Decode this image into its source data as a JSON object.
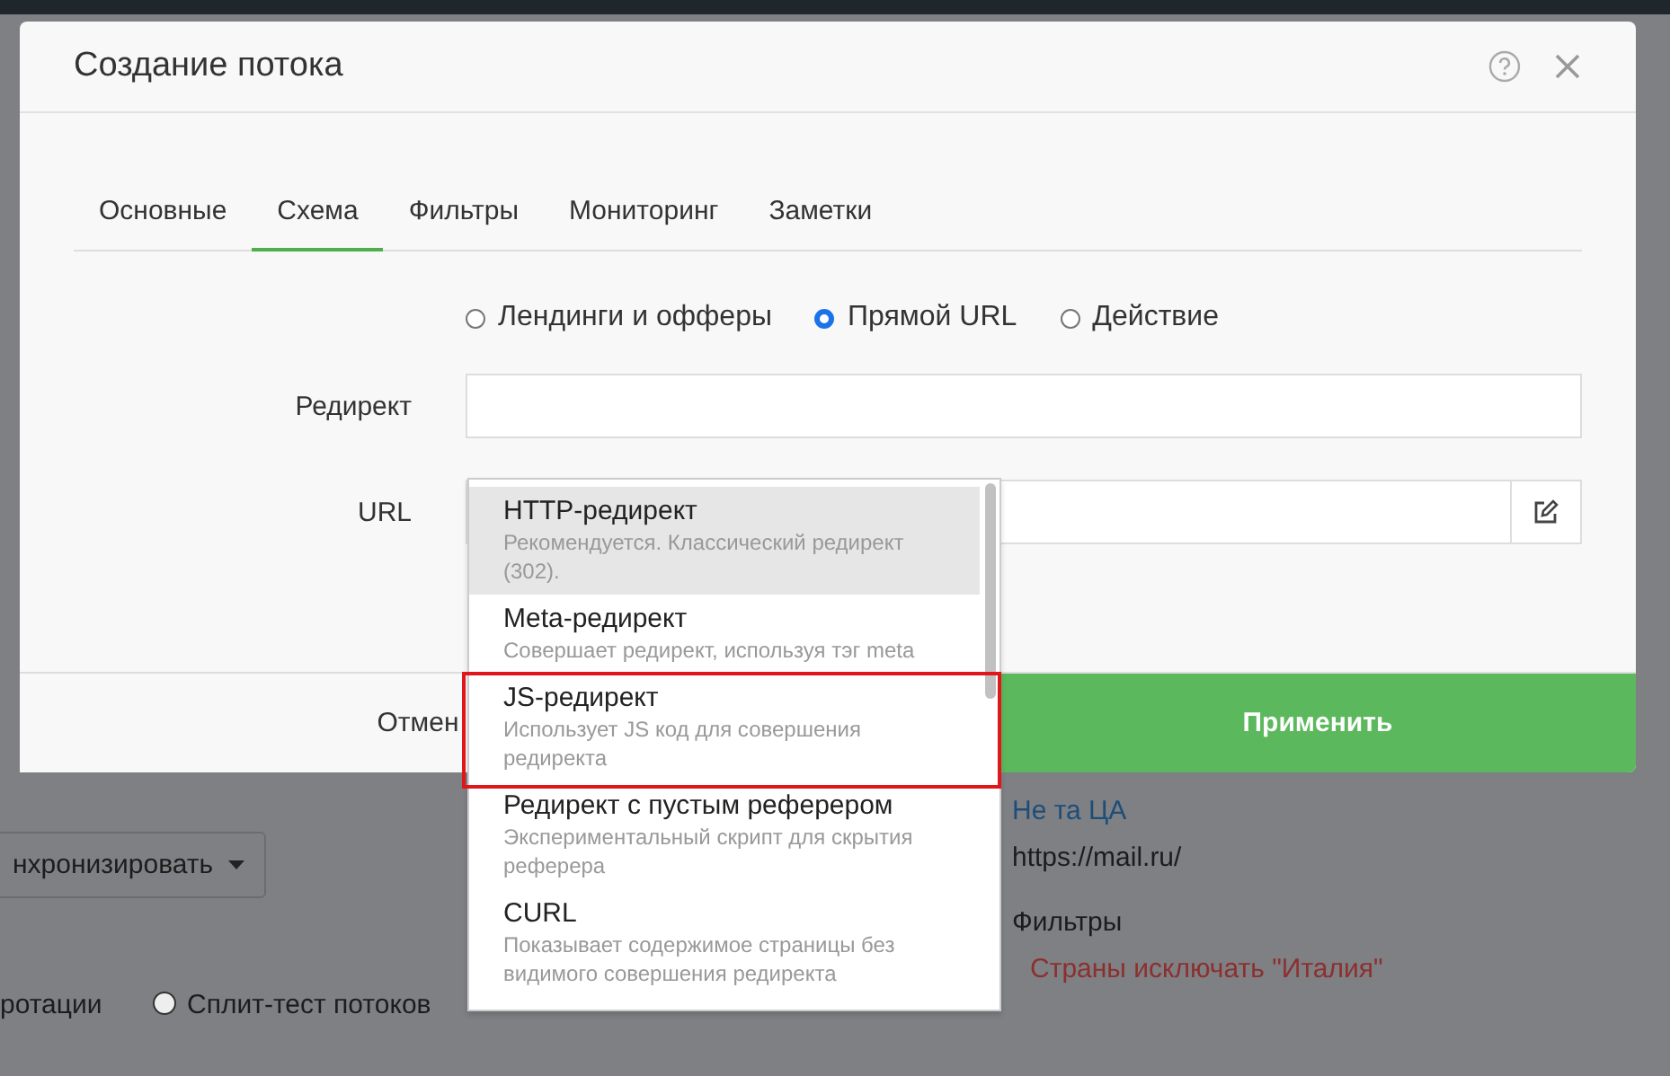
{
  "modal": {
    "title": "Создание потока",
    "tabs": [
      {
        "label": "Основные",
        "selected": false
      },
      {
        "label": "Схема",
        "selected": true
      },
      {
        "label": "Фильтры",
        "selected": false
      },
      {
        "label": "Мониторинг",
        "selected": false
      },
      {
        "label": "Заметки",
        "selected": false
      }
    ],
    "scheme_options": [
      {
        "label": "Лендинги и офферы",
        "selected": false
      },
      {
        "label": "Прямой URL",
        "selected": true
      },
      {
        "label": "Действие",
        "selected": false
      }
    ],
    "redirect_label": "Редирект",
    "url_label": "URL",
    "cancel_button": "Отмен",
    "apply_button": "Применить"
  },
  "dropdown": {
    "items": [
      {
        "title": "HTTP-редирект",
        "description": "Рекомендуется. Классический редирект (302).",
        "selected": true,
        "highlighted": false
      },
      {
        "title": "Meta-редирект",
        "description": "Совершает редирект, используя тэг meta",
        "selected": false,
        "highlighted": false
      },
      {
        "title": "JS-редирект",
        "description": "Использует JS код для совершения редиректа",
        "selected": false,
        "highlighted": true
      },
      {
        "title": "Редирект с пустым реферером",
        "description": "Экспериментальный скрипт для скрытия реферера",
        "selected": false,
        "highlighted": false
      },
      {
        "title": "CURL",
        "description": "Показывает содержимое страницы без видимого совершения редиректа",
        "selected": false,
        "highlighted": false
      }
    ]
  },
  "background": {
    "sync_button": "нхронизировать",
    "rotation_label": "ротации",
    "split_test": {
      "label": "Сплит-тест потоков",
      "selected": false
    },
    "link": "Не та ЦА",
    "url": "https://mail.ru/",
    "filters_label": "Фильтры",
    "filter_rule": "Страны исключать \"Италия\""
  }
}
